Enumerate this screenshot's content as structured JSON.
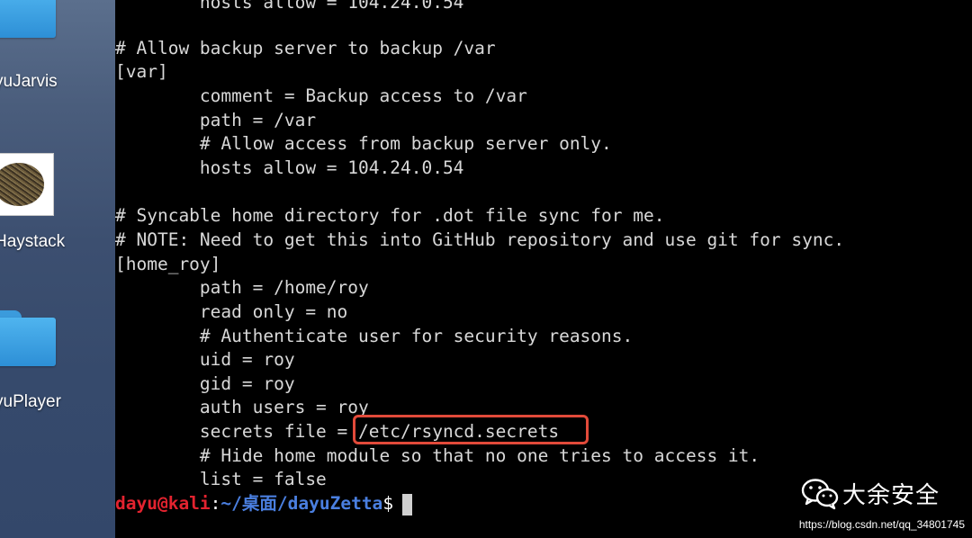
{
  "desktop": {
    "items": [
      {
        "label": "yuJarvis",
        "kind": "folder"
      },
      {
        "label": "Haystack",
        "kind": "image"
      },
      {
        "label": "yuPlayer",
        "kind": "folder"
      }
    ]
  },
  "terminal": {
    "lines": [
      "        hosts allow = 104.24.0.54",
      "",
      "# Allow backup server to backup /var",
      "[var]",
      "        comment = Backup access to /var",
      "        path = /var",
      "        # Allow access from backup server only.",
      "        hosts allow = 104.24.0.54",
      "",
      "# Syncable home directory for .dot file sync for me.",
      "# NOTE: Need to get this into GitHub repository and use git for sync.",
      "[home_roy]",
      "        path = /home/roy",
      "        read only = no",
      "        # Authenticate user for security reasons.",
      "        uid = roy",
      "        gid = roy",
      "        auth users = roy",
      "        secrets file = /etc/rsyncd.secrets",
      "        # Hide home module so that no one tries to access it.",
      "        list = false"
    ],
    "prompt": {
      "user_host": "dayu@kali",
      "colon": ":",
      "path": "~/桌面/dayuZetta",
      "dollar": "$"
    }
  },
  "watermark": {
    "brand": "大余安全",
    "icon": "wechat-icon",
    "url": "https://blog.csdn.net/qq_34801745"
  },
  "colors": {
    "highlight": "#e24a3a",
    "prompt_user": "#e3232f",
    "prompt_path": "#4a7fe0"
  }
}
